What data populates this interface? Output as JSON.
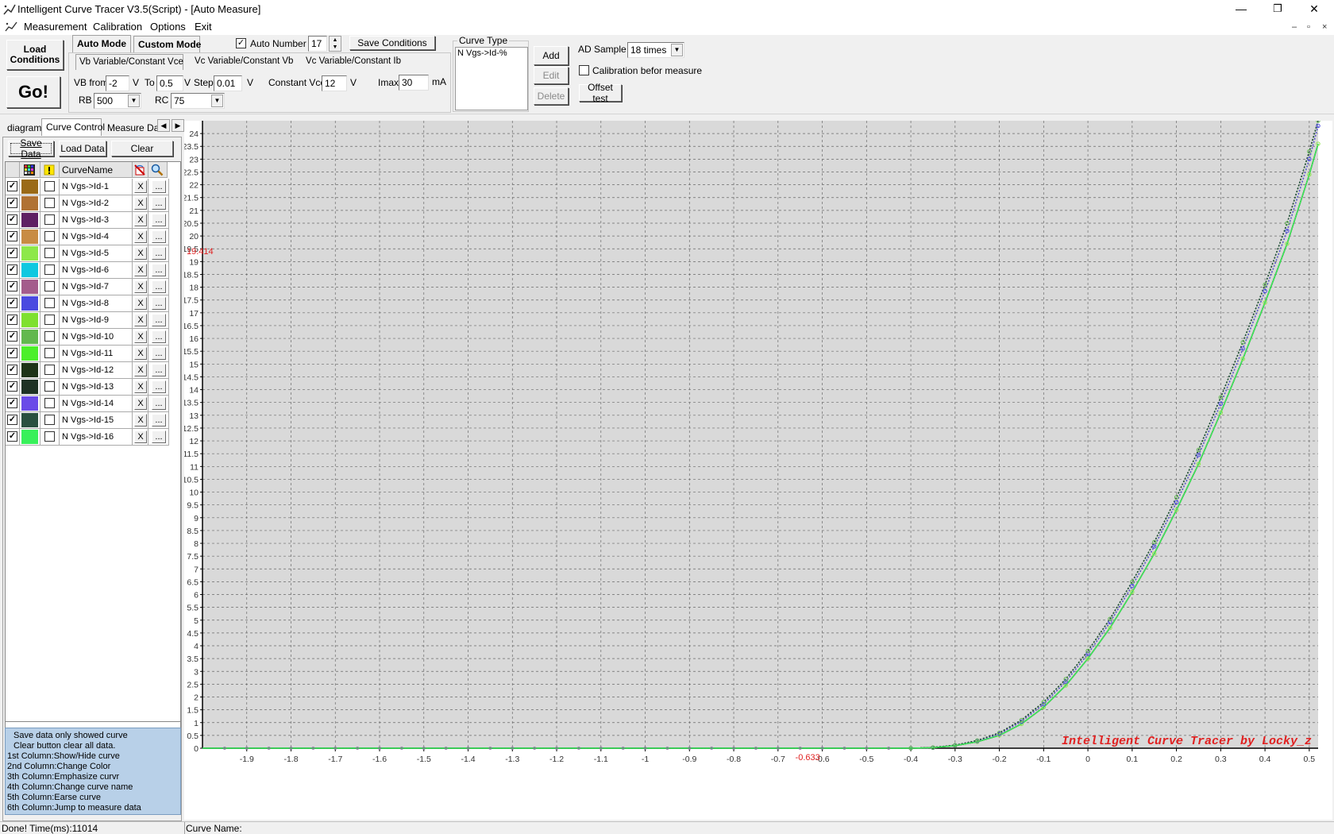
{
  "window": {
    "title": "Intelligent Curve Tracer V3.5(Script) - [Auto Measure]",
    "minimize": "—",
    "restore": "❐",
    "close": "✕"
  },
  "menu": {
    "items": [
      "Measurement",
      "Calibration",
      "Options",
      "Exit"
    ],
    "mdi": {
      "minimize": "–",
      "restore": "▫",
      "close": "×"
    }
  },
  "toolbar": {
    "load_conditions": "Load Conditions",
    "go": "Go!",
    "modes": [
      "Auto Mode",
      "Custom Mode"
    ],
    "auto_number_label": "Auto Number",
    "auto_number_checked": true,
    "auto_number_value": "17",
    "save_conditions": "Save Conditions",
    "sub_tabs": [
      "Vb Variable/Constant Vce",
      "Vc Variable/Constant Vb",
      "Vc Variable/Constant Ib"
    ],
    "vb_from_label": "VB from",
    "vb_from_value": "-2",
    "v_unit": "V",
    "to_label": "To",
    "to_value": "0.5",
    "step_label": "Step",
    "step_value": "0.01",
    "constant_vce_label": "Constant Vce",
    "constant_vce_value": "12",
    "imax_label": "Imax",
    "imax_value": "30",
    "ma_unit": "mA",
    "rb_label": "RB",
    "rb_value": "500",
    "rc_label": "RC",
    "rc_value": "75"
  },
  "curve_type": {
    "title": "Curve Type",
    "items": [
      "N Vgs->Id-%"
    ],
    "add": "Add",
    "edit": "Edit",
    "delete": "Delete"
  },
  "ad": {
    "ad_sample_label": "AD Sample",
    "ad_sample_value": "18 times",
    "calibration_label": "Calibration befor measure",
    "calibration_checked": false,
    "offset_test": "Offset test"
  },
  "left_tabs": [
    "diagram",
    "Curve Control",
    "Measure Data"
  ],
  "left_tab_arrows": {
    "left": "◀",
    "right": "▶"
  },
  "curve_control": {
    "save_data": "Save Data",
    "load_data": "Load Data",
    "clear": "Clear",
    "header_name": "CurveName",
    "header_icons": [
      "color-grid-icon",
      "warning-icon",
      "erase-icon",
      "search-icon"
    ],
    "x_label": "X",
    "more_label": "...",
    "check_mark": "✓",
    "curves": [
      {
        "name": "N Vgs->Id-1",
        "color": "#9a6a17"
      },
      {
        "name": "N Vgs->Id-2",
        "color": "#b07234"
      },
      {
        "name": "N Vgs->Id-3",
        "color": "#5e1f63"
      },
      {
        "name": "N Vgs->Id-4",
        "color": "#c88c44"
      },
      {
        "name": "N Vgs->Id-5",
        "color": "#8de84a"
      },
      {
        "name": "N Vgs->Id-6",
        "color": "#0fc8e0"
      },
      {
        "name": "N Vgs->Id-7",
        "color": "#a45c8c"
      },
      {
        "name": "N Vgs->Id-8",
        "color": "#4a4ae0"
      },
      {
        "name": "N Vgs->Id-9",
        "color": "#7ee030"
      },
      {
        "name": "N Vgs->Id-10",
        "color": "#62b84e"
      },
      {
        "name": "N Vgs->Id-11",
        "color": "#4cef2a"
      },
      {
        "name": "N Vgs->Id-12",
        "color": "#1e3418"
      },
      {
        "name": "N Vgs->Id-13",
        "color": "#1e3224"
      },
      {
        "name": "N Vgs->Id-14",
        "color": "#6a4ae8"
      },
      {
        "name": "N Vgs->Id-15",
        "color": "#2a5040"
      },
      {
        "name": "N Vgs->Id-16",
        "color": "#38f05a"
      }
    ]
  },
  "help_lines": [
    "Save data only showed curve",
    "Clear button clear all data.",
    "1st Column:Show/Hide curve",
    "2nd Column:Change Color",
    "3th Column:Emphasize curvr",
    "4th Column:Change curve name",
    "5th Column:Earse curve",
    "6th Column:Jump to measure data"
  ],
  "chart_data": {
    "type": "line",
    "xlim": [
      -2.0,
      0.52
    ],
    "ylim": [
      0,
      24.5
    ],
    "x_ticks": [
      -1.9,
      -1.8,
      -1.7,
      -1.6,
      -1.5,
      -1.4,
      -1.3,
      -1.2,
      -1.1,
      -1,
      -0.9,
      -0.8,
      -0.7,
      -0.6,
      -0.5,
      -0.4,
      -0.3,
      -0.2,
      -0.1,
      0,
      0.1,
      0.2,
      0.3,
      0.4,
      0.5
    ],
    "y_ticks": [
      0,
      0.5,
      1,
      1.5,
      2,
      2.5,
      3,
      3.5,
      4,
      4.5,
      5,
      5.5,
      6,
      6.5,
      7,
      7.5,
      8,
      8.5,
      9,
      9.5,
      10,
      10.5,
      11,
      11.5,
      12,
      12.5,
      13,
      13.5,
      14,
      14.5,
      15,
      15.5,
      16,
      16.5,
      17,
      17.5,
      18,
      18.5,
      19,
      19.5,
      20,
      20.5,
      21,
      21.5,
      22,
      22.5,
      23,
      23.5,
      24
    ],
    "grid": true,
    "cursor_x_label": "-0.633",
    "cursor_y_label": "19.414",
    "cursor_color": "#e02020",
    "watermark": "Intelligent Curve Tracer by Locky_z",
    "watermark_color": "#e02020",
    "x": [
      -2.0,
      -0.4,
      -0.35,
      -0.3,
      -0.25,
      -0.2,
      -0.15,
      -0.1,
      -0.05,
      0,
      0.05,
      0.1,
      0.15,
      0.2,
      0.25,
      0.3,
      0.35,
      0.4,
      0.45,
      0.5,
      0.52
    ],
    "series": [
      {
        "values": [
          0,
          0,
          0.02,
          0.1,
          0.25,
          0.5,
          0.95,
          1.6,
          2.45,
          3.5,
          4.7,
          6.1,
          7.6,
          9.3,
          11.1,
          13.1,
          15.2,
          17.4,
          19.7,
          22.4,
          23.6
        ]
      },
      {
        "values": [
          0,
          0,
          0.02,
          0.11,
          0.28,
          0.56,
          1.04,
          1.72,
          2.6,
          3.68,
          4.92,
          6.34,
          7.88,
          9.6,
          11.45,
          13.45,
          15.6,
          17.85,
          20.2,
          23.0,
          24.3
        ]
      },
      {
        "values": [
          0,
          0,
          0.03,
          0.12,
          0.3,
          0.6,
          1.1,
          1.8,
          2.7,
          3.8,
          5.05,
          6.5,
          8.05,
          9.8,
          11.65,
          13.7,
          15.85,
          18.1,
          20.5,
          23.3,
          24.5
        ]
      }
    ]
  },
  "status": {
    "left": "Done!  Time(ms):11014",
    "curve_name_label": "Curve Name:"
  }
}
